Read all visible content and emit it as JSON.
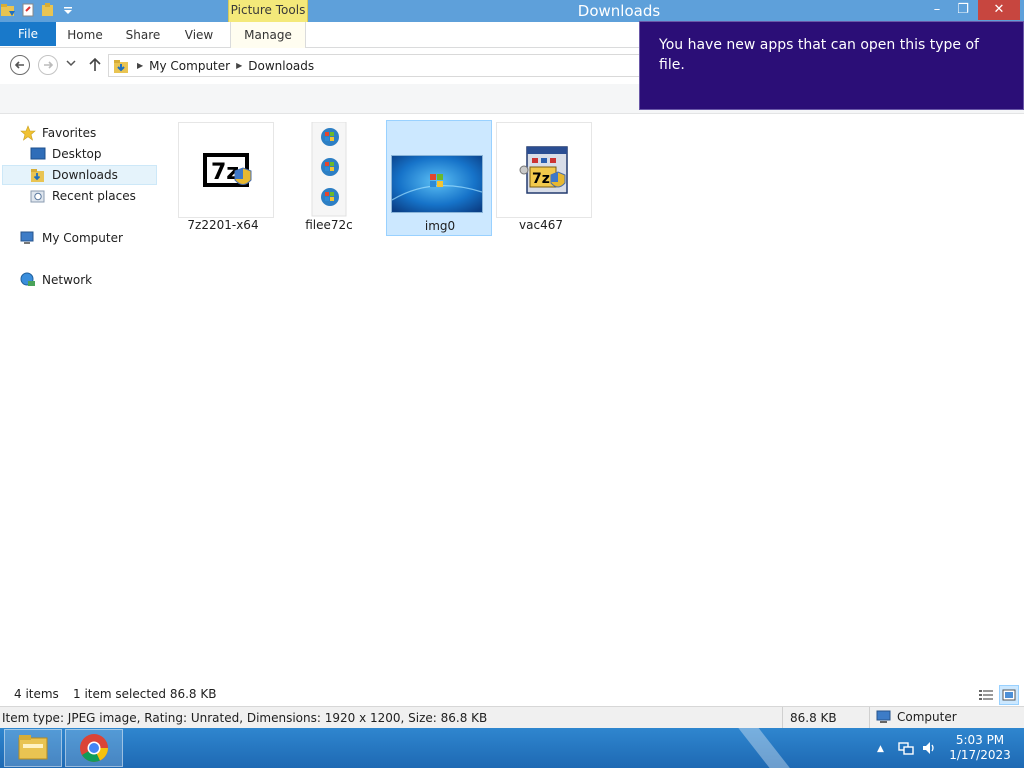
{
  "window": {
    "title": "Downloads",
    "contextual_tab_group": "Picture Tools",
    "controls": {
      "minimize": "–",
      "restore": "❐",
      "close": "✕"
    }
  },
  "ribbon": {
    "tabs": [
      {
        "label": "File",
        "active": false
      },
      {
        "label": "Home"
      },
      {
        "label": "Share"
      },
      {
        "label": "View"
      },
      {
        "label": "Manage"
      }
    ]
  },
  "address": {
    "breadcrumbs": [
      "My Computer",
      "Downloads"
    ]
  },
  "navpane": {
    "favorites": "Favorites",
    "desktop": "Desktop",
    "downloads": "Downloads",
    "recent": "Recent places",
    "computer": "My Computer",
    "network": "Network"
  },
  "files": [
    {
      "name": "7z2201-x64",
      "icon": "7zip-installer-icon",
      "selected": false
    },
    {
      "name": "filee72c",
      "icon": "windows-orbs-icon",
      "selected": false
    },
    {
      "name": "img0",
      "icon": "image-thumbnail",
      "selected": true
    },
    {
      "name": "vac467",
      "icon": "7zip-setup-icon",
      "selected": false
    }
  ],
  "toast": {
    "message": "You have new apps that can open this type of file."
  },
  "status": {
    "item_count": "4 items",
    "selection": "1 item selected  86.8 KB",
    "details": "Item type: JPEG image, Rating: Unrated, Dimensions: 1920 x 1200, Size: 86.8 KB",
    "size": "86.8 KB",
    "location": "Computer"
  },
  "taskbar": {
    "time": "5:03 PM",
    "date": "1/17/2023"
  },
  "colors": {
    "titlebar": "#5ea0da",
    "file_tab": "#1979ca",
    "picture_tools": "#f4e97a",
    "toast": "#2b0e77",
    "selection": "#cce8ff",
    "close_button": "#c7463f"
  }
}
